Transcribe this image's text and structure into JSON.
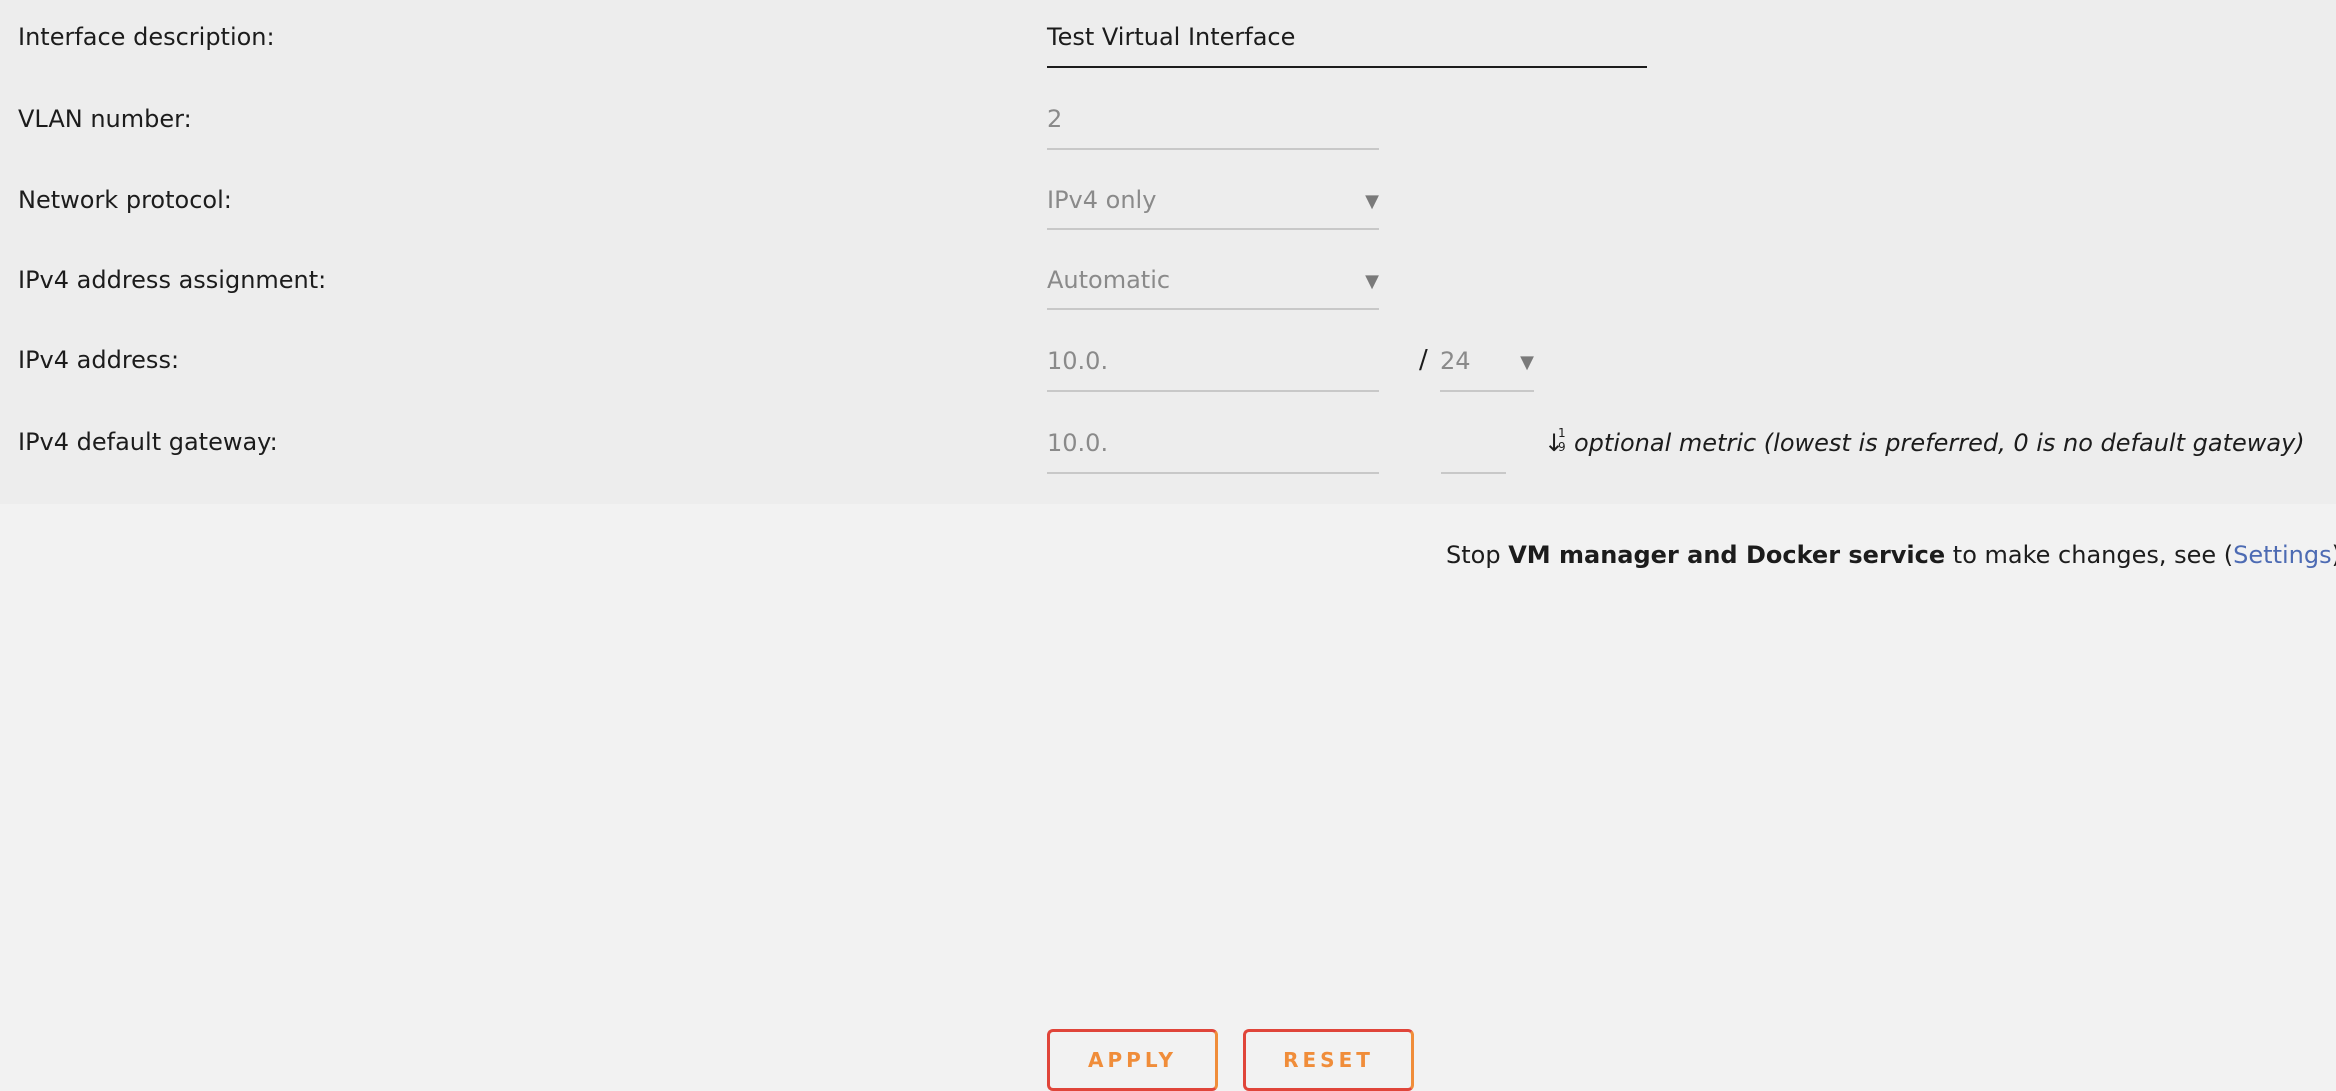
{
  "form": {
    "description": {
      "label": "Interface description:",
      "value": "Test Virtual Interface"
    },
    "vlan": {
      "label": "VLAN number:",
      "value": "2"
    },
    "protocol": {
      "label": "Network protocol:",
      "value": "IPv4 only"
    },
    "assignment": {
      "label": "IPv4 address assignment:",
      "value": "Automatic"
    },
    "address": {
      "label": "IPv4 address:",
      "value": "10.0.",
      "separator": "/",
      "prefix": "24"
    },
    "gateway": {
      "label": "IPv4 default gateway:",
      "value": "10.0.",
      "metric_value": "",
      "metric_icon_top": "1",
      "metric_icon_bottom": "9",
      "metric_note": "optional metric (lowest is preferred, 0 is no default gateway)"
    }
  },
  "actions": {
    "apply_label": "APPLY",
    "reset_label": "RESET"
  },
  "notice": {
    "prefix": "Stop ",
    "bold": "VM manager and Docker service",
    "middle": " to make changes, see (",
    "link": "Settings",
    "suffix": ")"
  },
  "colors": {
    "accent_orange": "#f08d3a",
    "accent_red": "#e0453a",
    "link_blue": "#4d6bb3"
  },
  "icons": {
    "dropdown": "triangle-down",
    "metric": "sort-numeric-down"
  }
}
